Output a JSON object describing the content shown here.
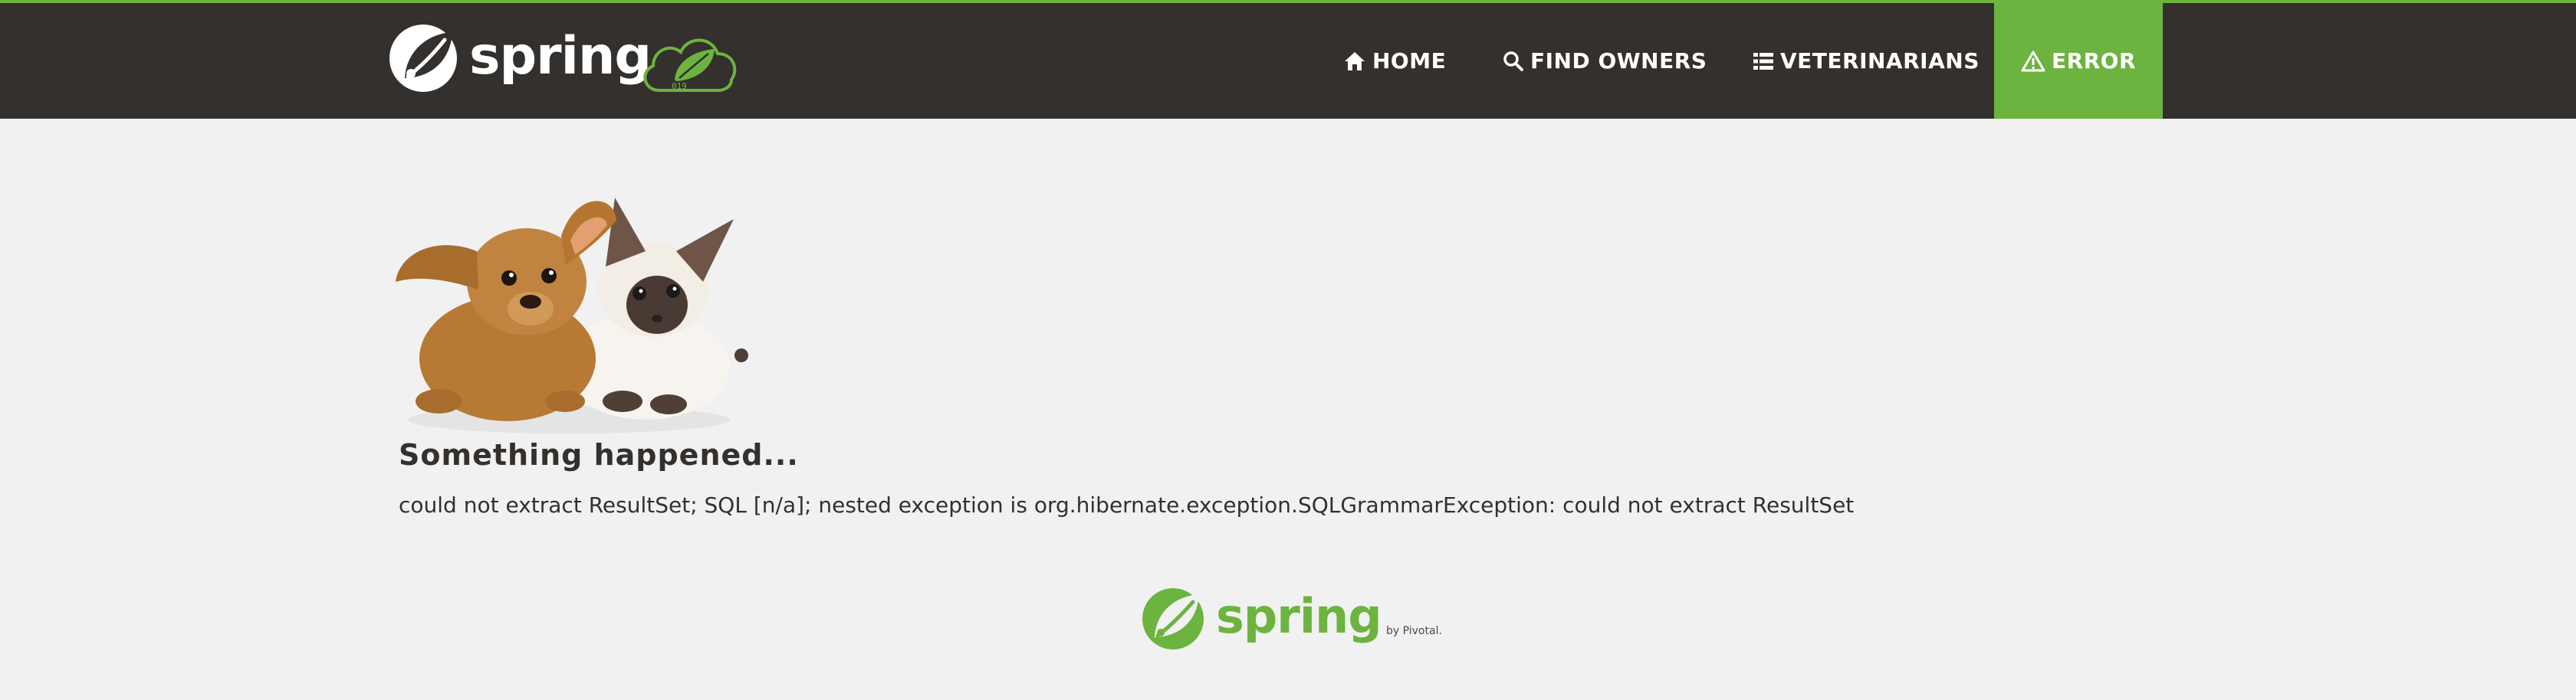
{
  "header": {
    "brand_name": "spring",
    "brand_badge": "019"
  },
  "nav": {
    "items": [
      {
        "label": "HOME",
        "icon": "home-icon",
        "active": false
      },
      {
        "label": "FIND OWNERS",
        "icon": "search-icon",
        "active": false
      },
      {
        "label": "VETERINARIANS",
        "icon": "list-icon",
        "active": false
      },
      {
        "label": "ERROR",
        "icon": "warning-icon",
        "active": true
      }
    ]
  },
  "main": {
    "image_alt": "pets",
    "title": "Something happened...",
    "message": "could not extract ResultSet; SQL [n/a]; nested exception is org.hibernate.exception.SQLGrammarException: could not extract ResultSet"
  },
  "footer": {
    "brand_name": "spring",
    "by_text": "by Pivotal."
  },
  "colors": {
    "accent": "#6db33f",
    "navbar": "#34302d",
    "background": "#f1f1f1",
    "text": "#34302d"
  }
}
